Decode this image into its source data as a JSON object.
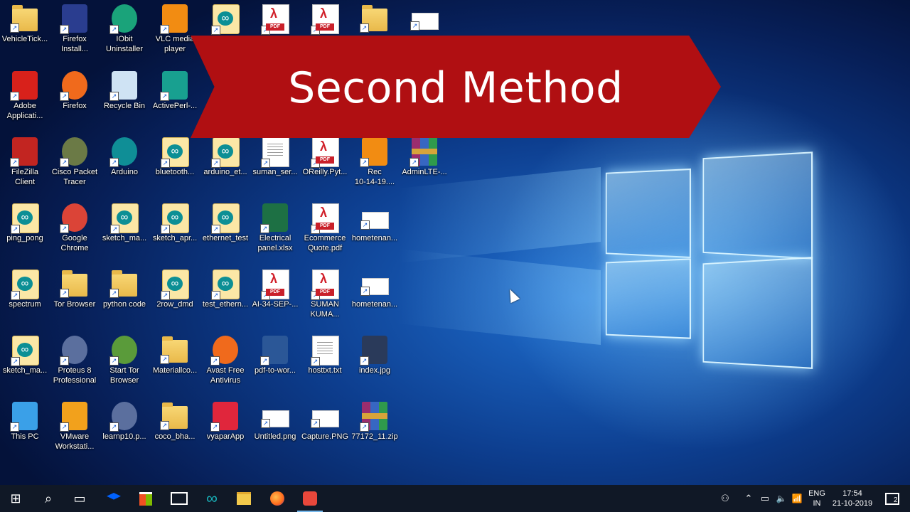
{
  "banner": {
    "title": "Second Method"
  },
  "desktop": {
    "icons": [
      {
        "label": "VehicleTick...",
        "kind": "folder"
      },
      {
        "label": "Firefox\nInstall...",
        "kind": "square",
        "color": "#2a3d8f"
      },
      {
        "label": "IObit\nUninstaller",
        "kind": "circle",
        "color": "#1aa37a"
      },
      {
        "label": "VLC media\nplayer",
        "kind": "square",
        "color": "#f28c12"
      },
      {
        "label": "",
        "kind": "ino"
      },
      {
        "label": "",
        "kind": "pdf"
      },
      {
        "label": "",
        "kind": "pdf"
      },
      {
        "label": "",
        "kind": "folder"
      },
      {
        "label": "",
        "kind": "white"
      },
      {
        "label": "Adobe\nApplicati...",
        "kind": "square",
        "color": "#d8211b"
      },
      {
        "label": "Firefox",
        "kind": "circle",
        "color": "#f06a1c"
      },
      {
        "label": "Recycle Bin",
        "kind": "square",
        "color": "#cfe3f4"
      },
      {
        "label": "ActivePerl-...",
        "kind": "square",
        "color": "#18a090"
      },
      {
        "label": "FileZilla\nClient",
        "kind": "square",
        "color": "#c22521"
      },
      {
        "label": "Cisco Packet\nTracer",
        "kind": "circle",
        "color": "#6b7a46"
      },
      {
        "label": "Arduino",
        "kind": "circle",
        "color": "#0f8e96"
      },
      {
        "label": "bluetooth...",
        "kind": "ino"
      },
      {
        "label": "arduino_et...",
        "kind": "ino"
      },
      {
        "label": "suman_ser...",
        "kind": "doc"
      },
      {
        "label": "OReilly.Pyt...",
        "kind": "pdf"
      },
      {
        "label": "Rec\n10-14-19....",
        "kind": "square",
        "color": "#f28c12"
      },
      {
        "label": "AdminLTE-...",
        "kind": "zip"
      },
      {
        "label": "ping_pong",
        "kind": "ino"
      },
      {
        "label": "Google\nChrome",
        "kind": "circle",
        "color": "#db4437"
      },
      {
        "label": "sketch_ma...",
        "kind": "ino"
      },
      {
        "label": "sketch_apr...",
        "kind": "ino"
      },
      {
        "label": "ethernet_test",
        "kind": "ino"
      },
      {
        "label": "Electrical\npanel.xlsx",
        "kind": "square",
        "color": "#1d7044"
      },
      {
        "label": "Ecommerce\nQuote.pdf",
        "kind": "pdf"
      },
      {
        "label": "hometenan...",
        "kind": "white"
      },
      {
        "label": "spectrum",
        "kind": "ino"
      },
      {
        "label": "Tor Browser",
        "kind": "folder"
      },
      {
        "label": "python code",
        "kind": "folder"
      },
      {
        "label": "2row_dmd",
        "kind": "ino"
      },
      {
        "label": "test_ethern...",
        "kind": "ino"
      },
      {
        "label": "AI-34-SEP-...",
        "kind": "pdf"
      },
      {
        "label": "SUMAN\nKUMA...",
        "kind": "pdf"
      },
      {
        "label": "hometenan...",
        "kind": "white"
      },
      {
        "label": "sketch_ma...",
        "kind": "ino"
      },
      {
        "label": "Proteus 8\nProfessional",
        "kind": "circle",
        "color": "#5b6f9e"
      },
      {
        "label": "Start Tor\nBrowser",
        "kind": "circle",
        "color": "#5a9b3a"
      },
      {
        "label": "Materiallco...",
        "kind": "folder"
      },
      {
        "label": "Avast Free\nAntivirus",
        "kind": "circle",
        "color": "#f06a1c"
      },
      {
        "label": "pdf-to-wor...",
        "kind": "square",
        "color": "#2b5797"
      },
      {
        "label": "hosttxt.txt",
        "kind": "doc"
      },
      {
        "label": "index.jpg",
        "kind": "square",
        "color": "#2a3a5a"
      },
      {
        "label": "This PC",
        "kind": "square",
        "color": "#3aa0e8"
      },
      {
        "label": "VMware\nWorkstati...",
        "kind": "square",
        "color": "#f2a11c"
      },
      {
        "label": "learnp10.p...",
        "kind": "circle",
        "color": "#5b6f9e"
      },
      {
        "label": "coco_bha...",
        "kind": "folder"
      },
      {
        "label": "vyaparApp",
        "kind": "square",
        "color": "#e0263c"
      },
      {
        "label": "Untitled.png",
        "kind": "white"
      },
      {
        "label": "Capture.PNG",
        "kind": "white"
      },
      {
        "label": "77172_11.zip",
        "kind": "zip"
      }
    ]
  },
  "taskbar": {
    "start_glyph": "⊞",
    "search_glyph": "⌕",
    "taskview_glyph": "▭",
    "tray": {
      "people_glyph": "⚇",
      "chevron_glyph": "⌃",
      "battery_glyph": "▭",
      "volume_glyph": "🔈",
      "network_glyph": "📶",
      "language_top": "ENG",
      "language_bottom": "IN",
      "time": "17:54",
      "date": "21-10-2019",
      "notification_count": "2"
    }
  }
}
